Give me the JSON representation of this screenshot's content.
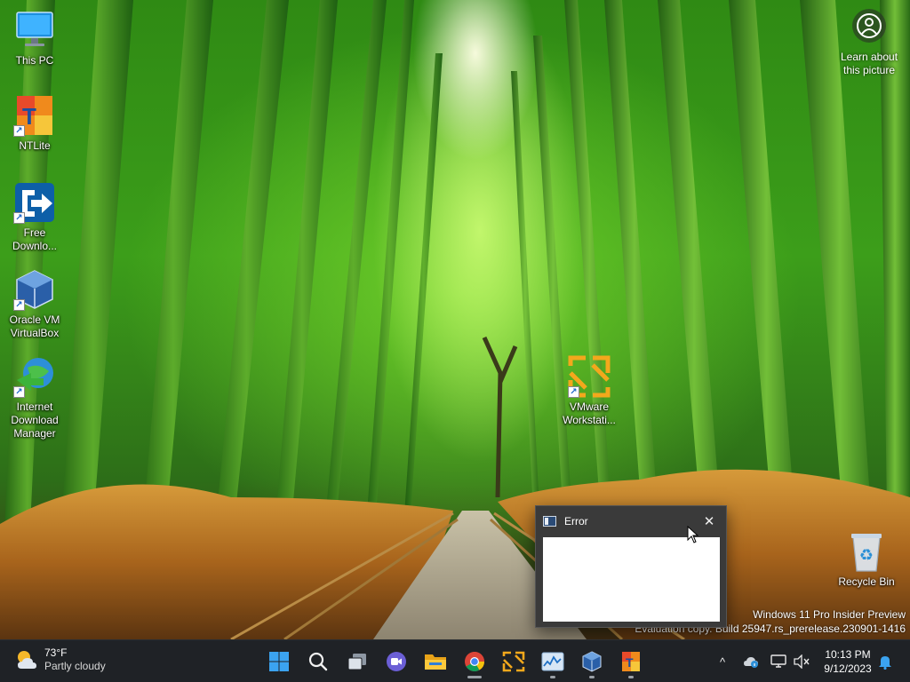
{
  "desktop": {
    "icons": [
      {
        "label": "This PC"
      },
      {
        "label": "NTLite"
      },
      {
        "label": "Free\nDownlo..."
      },
      {
        "label": "Oracle VM\nVirtualBox"
      },
      {
        "label": "Internet\nDownload\nManager"
      },
      {
        "label": "VMware\nWorkstati..."
      },
      {
        "label": "Recycle Bin"
      }
    ],
    "learn_about_picture": "Learn about\nthis picture",
    "watermark": {
      "line1": "Windows 11 Pro Insider Preview",
      "line2": "Evaluation copy. Build 25947.rs_prerelease.230901-1416"
    }
  },
  "dialog": {
    "title": "Error",
    "close_symbol": "✕"
  },
  "taskbar": {
    "weather": {
      "temp": "73°F",
      "condition": "Partly cloudy"
    },
    "apps": [
      {
        "name": "Start",
        "icon": "windows-logo-icon"
      },
      {
        "name": "Search",
        "icon": "search-icon"
      },
      {
        "name": "Task View",
        "icon": "task-view-icon"
      },
      {
        "name": "Meet / Teams",
        "icon": "video-chat-icon"
      },
      {
        "name": "File Explorer",
        "icon": "folder-icon"
      },
      {
        "name": "Google Chrome",
        "icon": "chrome-icon"
      },
      {
        "name": "VMware Workstation",
        "icon": "vmware-icon"
      },
      {
        "name": "Task Manager",
        "icon": "performance-graph-icon"
      },
      {
        "name": "Oracle VM VirtualBox",
        "icon": "virtualbox-icon"
      },
      {
        "name": "NTLite",
        "icon": "ntlite-icon"
      }
    ],
    "tray": {
      "chevron": "^",
      "time": "10:13 PM",
      "date": "9/12/2023"
    }
  },
  "colors": {
    "taskbar_bg": "#1f2226",
    "dialog_bg": "#3a3a3a",
    "accent_blue": "#3ba3f0"
  }
}
